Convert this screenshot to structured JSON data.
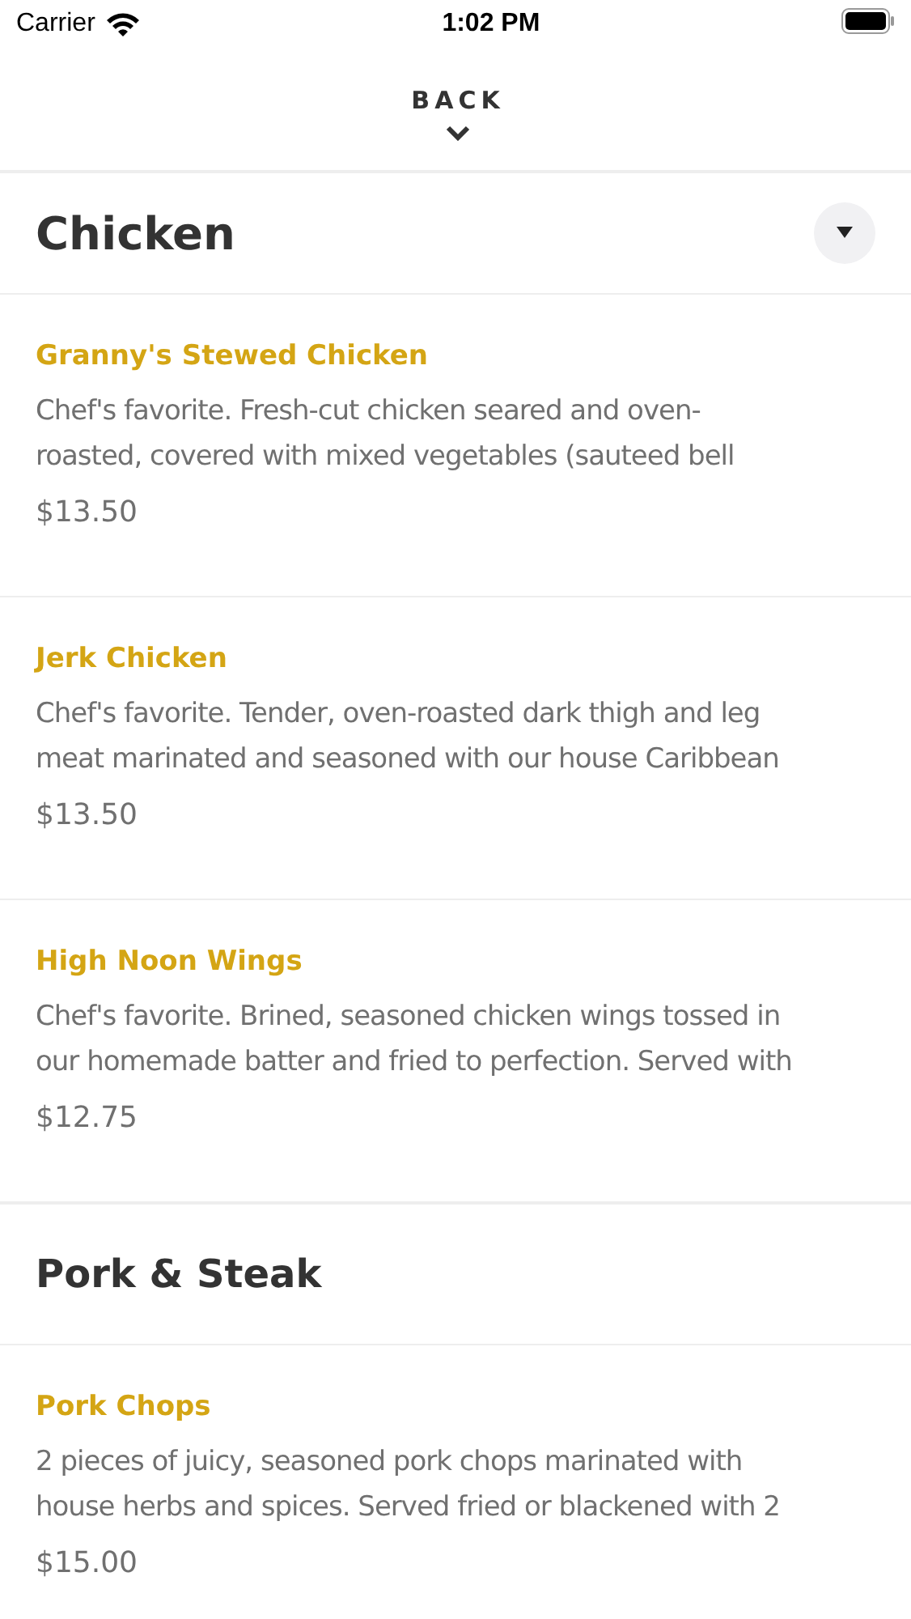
{
  "status_bar": {
    "carrier": "Carrier",
    "time": "1:02 PM"
  },
  "header": {
    "back": "BACK"
  },
  "sections": [
    {
      "title": "Chicken",
      "dropdown": true,
      "items": [
        {
          "name": "Granny's Stewed Chicken",
          "lines": [
            "Chef's favorite. Fresh-cut chicken seared and oven-",
            "roasted, covered with mixed vegetables (sauteed bell"
          ],
          "price": "$13.50"
        },
        {
          "name": "Jerk Chicken",
          "lines": [
            "Chef's favorite. Tender, oven-roasted dark thigh and leg",
            "meat marinated and seasoned with our house Caribbean"
          ],
          "price": "$13.50"
        },
        {
          "name": "High Noon Wings",
          "lines": [
            "Chef's favorite. Brined, seasoned chicken wings tossed in",
            "our homemade batter and fried to perfection. Served with"
          ],
          "price": "$12.75"
        }
      ]
    },
    {
      "title": "Pork & Steak",
      "dropdown": false,
      "items": [
        {
          "name": "Pork Chops",
          "lines": [
            "2 pieces of juicy, seasoned pork chops marinated with",
            "house herbs and spices. Served fried or blackened with 2"
          ],
          "price": "$15.00"
        }
      ]
    }
  ]
}
